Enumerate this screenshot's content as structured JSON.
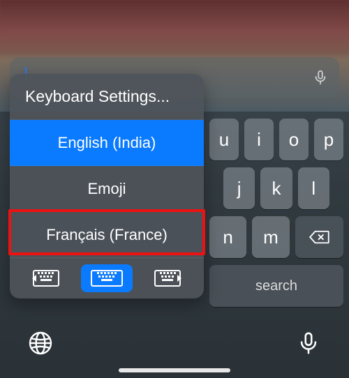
{
  "search": {
    "placeholder": ""
  },
  "popover": {
    "settings_label": "Keyboard Settings...",
    "languages": [
      {
        "label": "English (India)",
        "selected": true
      },
      {
        "label": "Emoji",
        "selected": false
      },
      {
        "label": "Français (France)",
        "selected": false,
        "highlighted": true
      }
    ],
    "modes": {
      "left": "dock-left",
      "center": "full",
      "right": "dock-right",
      "active": "center"
    }
  },
  "keyboard": {
    "row1_visible": [
      "u",
      "i",
      "o",
      "p"
    ],
    "row2_visible": [
      "j",
      "k",
      "l"
    ],
    "row3_visible": [
      "n",
      "m"
    ],
    "search_label": "search"
  },
  "icons": {
    "mic": "mic-icon",
    "globe": "globe-icon",
    "backspace": "backspace-icon"
  }
}
